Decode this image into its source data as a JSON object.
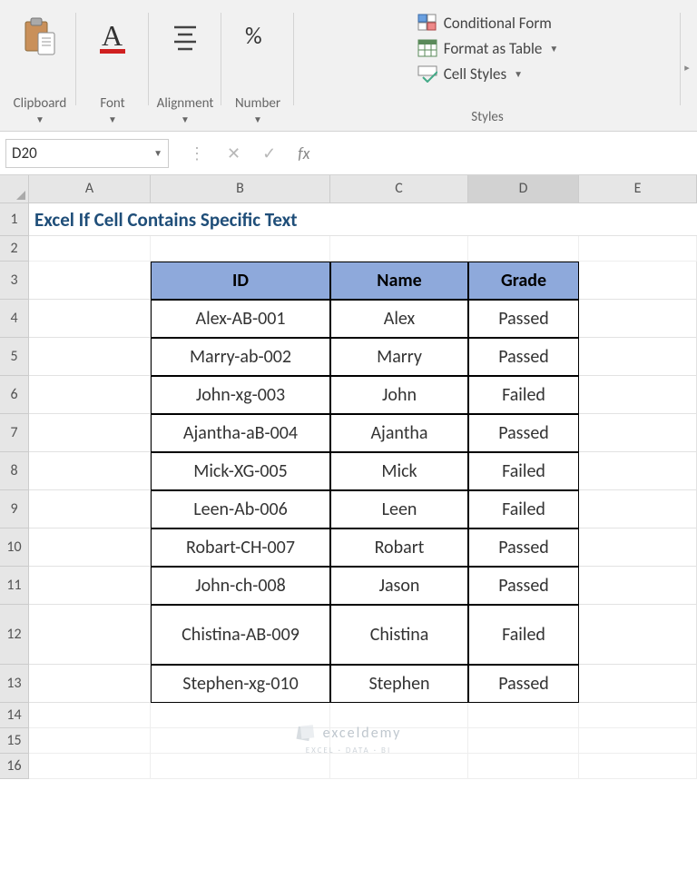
{
  "ribbon": {
    "clipboard": "Clipboard",
    "font": "Font",
    "alignment": "Alignment",
    "number": "Number",
    "styles_label": "Styles",
    "styles": {
      "conditional": "Conditional Form",
      "table": "Format as Table",
      "cell": "Cell Styles"
    }
  },
  "name_box": "D20",
  "fx": "fx",
  "columns": [
    "A",
    "B",
    "C",
    "D",
    "E"
  ],
  "rows": [
    "1",
    "2",
    "3",
    "4",
    "5",
    "6",
    "7",
    "8",
    "9",
    "10",
    "11",
    "12",
    "13",
    "14",
    "15",
    "16"
  ],
  "title": "Excel If Cell Contains Specific Text",
  "headers": {
    "id": "ID",
    "name": "Name",
    "grade": "Grade"
  },
  "data": [
    {
      "id": "Alex-AB-001",
      "name": "Alex",
      "grade": "Passed"
    },
    {
      "id": "Marry-ab-002",
      "name": "Marry",
      "grade": "Passed"
    },
    {
      "id": "John-xg-003",
      "name": "John",
      "grade": "Failed"
    },
    {
      "id": "Ajantha-aB-004",
      "name": "Ajantha",
      "grade": "Passed"
    },
    {
      "id": "Mick-XG-005",
      "name": "Mick",
      "grade": "Failed"
    },
    {
      "id": "Leen-Ab-006",
      "name": "Leen",
      "grade": "Failed"
    },
    {
      "id": "Robart-CH-007",
      "name": "Robart",
      "grade": "Passed"
    },
    {
      "id": "John-ch-008",
      "name": "Jason",
      "grade": "Passed"
    },
    {
      "id": "Chistina-AB-009",
      "name": "Chistina",
      "grade": "Failed"
    },
    {
      "id": "Stephen-xg-010",
      "name": "Stephen",
      "grade": "Passed"
    }
  ],
  "watermark": "exceldemy",
  "watermark_sub": "EXCEL · DATA · BI"
}
